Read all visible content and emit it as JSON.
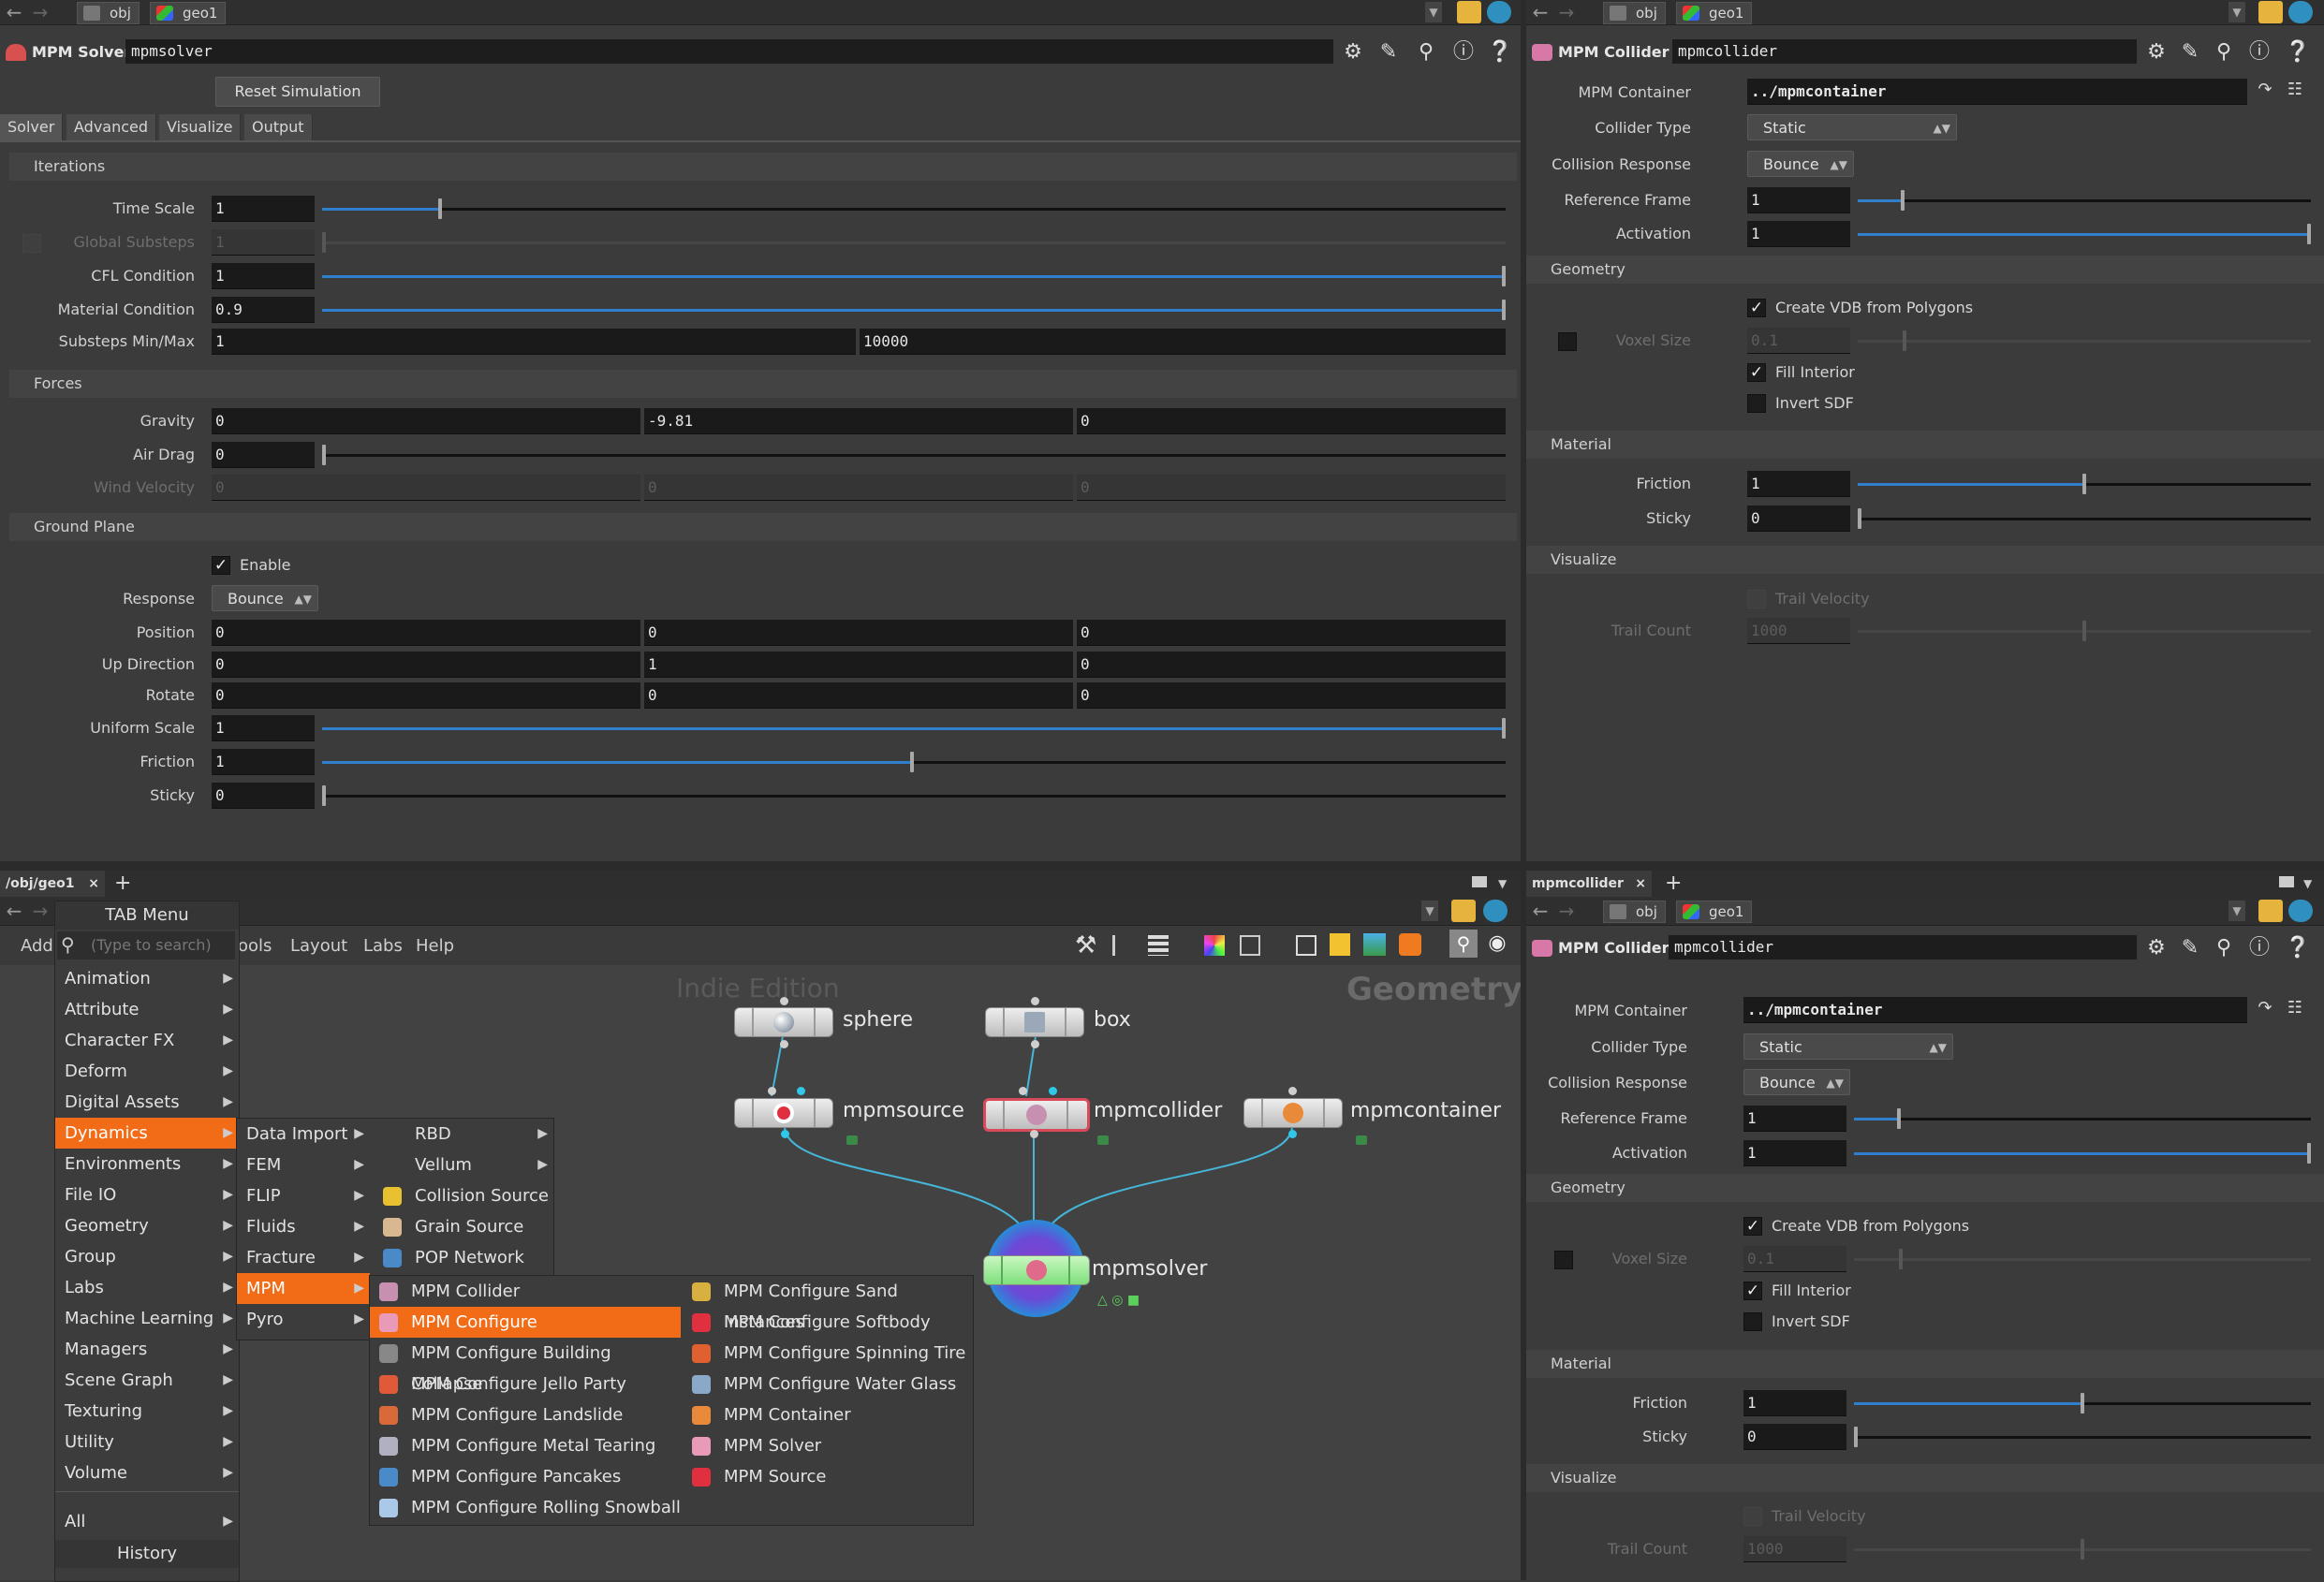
{
  "path": {
    "obj": "obj",
    "geo": "geo1"
  },
  "solver": {
    "type": "MPM Solver",
    "name": "mpmsolver",
    "reset_button": "Reset Simulation",
    "tabs": [
      "Solver",
      "Advanced",
      "Visualize",
      "Output"
    ],
    "sections": {
      "iterations": "Iterations",
      "forces": "Forces",
      "ground": "Ground Plane"
    },
    "params": {
      "time_scale": {
        "label": "Time Scale",
        "value": "1"
      },
      "global_substeps": {
        "label": "Global Substeps",
        "value": "1"
      },
      "cfl": {
        "label": "CFL Condition",
        "value": "1"
      },
      "material_condition": {
        "label": "Material Condition",
        "value": "0.9"
      },
      "substeps": {
        "label": "Substeps Min/Max",
        "min": "1",
        "max": "10000"
      },
      "gravity": {
        "label": "Gravity",
        "x": "0",
        "y": "-9.81",
        "z": "0"
      },
      "air_drag": {
        "label": "Air Drag",
        "value": "0"
      },
      "wind_velocity": {
        "label": "Wind Velocity",
        "x": "0",
        "y": "0",
        "z": "0"
      },
      "enable": {
        "label": "Enable"
      },
      "response": {
        "label": "Response",
        "value": "Bounce"
      },
      "position": {
        "label": "Position",
        "x": "0",
        "y": "0",
        "z": "0"
      },
      "up_direction": {
        "label": "Up Direction",
        "x": "0",
        "y": "1",
        "z": "0"
      },
      "rotate": {
        "label": "Rotate",
        "x": "0",
        "y": "0",
        "z": "0"
      },
      "uniform_scale": {
        "label": "Uniform Scale",
        "value": "1"
      },
      "friction": {
        "label": "Friction",
        "value": "1"
      },
      "sticky": {
        "label": "Sticky",
        "value": "0"
      }
    }
  },
  "collider": {
    "type": "MPM Collider",
    "name": "mpmcollider",
    "container_label": "MPM Container",
    "container_value": "../mpmcontainer",
    "collider_type_label": "Collider Type",
    "collider_type": "Static",
    "collision_response_label": "Collision Response",
    "collision_response": "Bounce",
    "reference_frame_label": "Reference Frame",
    "reference_frame": "1",
    "activation_label": "Activation",
    "activation": "1",
    "geometry_section": "Geometry",
    "create_vdb": "Create VDB from Polygons",
    "voxel_size_label": "Voxel Size",
    "voxel_size": "0.1",
    "fill_interior": "Fill Interior",
    "invert_sdf": "Invert SDF",
    "material_section": "Material",
    "friction_label": "Friction",
    "friction": "1",
    "sticky_label": "Sticky",
    "sticky": "0",
    "visualize_section": "Visualize",
    "trail_velocity": "Trail Velocity",
    "trail_count_label": "Trail Count",
    "trail_count": "1000"
  },
  "network": {
    "pane_tab": "/obj/geo1",
    "pane_tab2": "mpmcollider",
    "menubar": [
      "Add",
      "ools",
      "Layout",
      "Labs",
      "Help"
    ],
    "watermark": "Indie Edition",
    "context": "Geometry",
    "nodes": {
      "sphere": "sphere",
      "box": "box",
      "source": "mpmsource",
      "collider": "mpmcollider",
      "container": "mpmcontainer",
      "solver": "mpmsolver"
    }
  },
  "tab_menu": {
    "title": "TAB Menu",
    "search_placeholder": "(Type to search)",
    "categories": [
      "Animation",
      "Attribute",
      "Character FX",
      "Deform",
      "Digital Assets",
      "Dynamics",
      "Environments",
      "File IO",
      "Geometry",
      "Group",
      "Labs",
      "Machine Learning",
      "Managers",
      "Scene Graph",
      "Texturing",
      "Utility",
      "Volume"
    ],
    "all": "All",
    "history": "History",
    "dynamics_sub": [
      "Data Import",
      "FEM",
      "FLIP",
      "Fluids",
      "Fracture",
      "MPM",
      "Pyro"
    ],
    "dynamics_col2": [
      "RBD",
      "Vellum",
      "Collision Source",
      "Grain Source",
      "POP Network"
    ],
    "mpm_col1": [
      "MPM Collider",
      "MPM Configure",
      "MPM Configure Building Collapse",
      "MPM Configure Jello Party",
      "MPM Configure Landslide",
      "MPM Configure Metal Tearing",
      "MPM Configure Pancakes",
      "MPM Configure Rolling Snowball"
    ],
    "mpm_col2": [
      "MPM Configure Sand Instances",
      "MPM Configure Softbody",
      "MPM Configure Spinning Tire",
      "MPM Configure Water Glass",
      "MPM Container",
      "MPM Solver",
      "MPM Source"
    ]
  },
  "colors": {
    "accent": "#f26b16",
    "slider": "#2f7fcc",
    "bg": "#3b3b3b",
    "field": "#1a1a1a"
  }
}
